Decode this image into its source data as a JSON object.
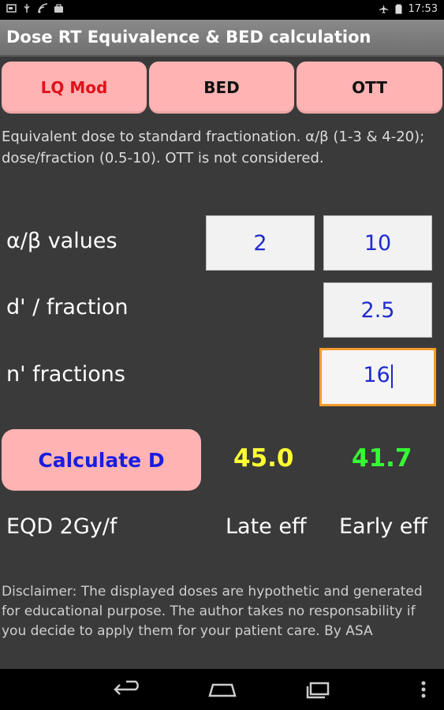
{
  "status": {
    "time": "17:53",
    "icons_left": [
      "notification-icon",
      "usb-icon",
      "wifi-signal-icon",
      "shopping-bag-icon"
    ],
    "icons_right": [
      "airplane-mode-icon",
      "battery-icon"
    ]
  },
  "app": {
    "title": "Dose RT Equivalence & BED calculation"
  },
  "tabs": [
    {
      "label": "LQ Mod",
      "active": true
    },
    {
      "label": "BED",
      "active": false
    },
    {
      "label": "OTT",
      "active": false
    }
  ],
  "description": "Equivalent dose to standard fractionation. α/β (1-3 & 4-20); dose/fraction (0.5-10). OTT is not considered.",
  "inputs": {
    "alpha_beta_label": "α/β values",
    "alpha_beta_late": "2",
    "alpha_beta_early": "10",
    "dose_fraction_label": "d' / fraction",
    "dose_fraction": "2.5",
    "n_fractions_label": "n' fractions",
    "n_fractions": "16"
  },
  "calculate": {
    "label": "Calculate D"
  },
  "results": {
    "late_value": "45.0",
    "early_value": "41.7",
    "late_color": "#ffff33",
    "early_color": "#33ff33",
    "row_label": "EQD 2Gy/f",
    "late_label": "Late eff",
    "early_label": "Early eff"
  },
  "disclaimer": "Disclaimer: The displayed doses are hypothetic and generated for educational purpose. The author takes no responsability if you decide to apply them for your patient care. By ASA"
}
